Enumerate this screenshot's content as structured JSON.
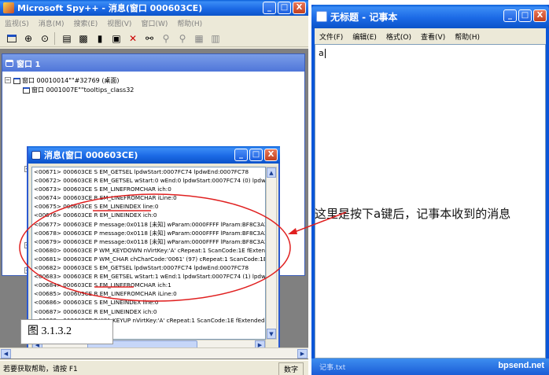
{
  "spy": {
    "title": "Microsoft Spy++ - 消息(窗口 000603CE)",
    "menu": [
      "监视(S)",
      "消息(M)",
      "搜索(E)",
      "视图(V)",
      "窗口(W)",
      "帮助(H)"
    ],
    "toolbar_icons": [
      "new-window-icon",
      "find-window-icon",
      "spy-icon",
      "messages-icon",
      "log-icon",
      "clear-icon",
      "delete-icon",
      "binoculars-icon",
      "find-next-icon",
      "find-prev-icon",
      "properties-icon",
      "refresh-icon"
    ],
    "status": "若要获取帮助，请按 F1",
    "status_num": "数字",
    "window_buttons": {
      "minimize": "_",
      "maximize": "□",
      "close": "X"
    }
  },
  "tree_window": {
    "title": "窗口 1",
    "rows": [
      "窗口 00010014\"\"#32769 (桌面)",
      "窗口 0001007E\"\"tooltips_class32"
    ]
  },
  "messages_window": {
    "title": "消息(窗口 000603CE)",
    "lines": [
      "<00671> 000603CE S EM_GETSEL lpdwStart:0007FC74 lpdwEnd:0007FC78",
      "<00672> 000603CE R EM_GETSEL wStart:0 wEnd:0 lpdwStart:0007FC74 (0) lpdwEn",
      "<00673> 000603CE S EM_LINEFROMCHAR ich:0",
      "<00674> 000603CE R EM_LINEFROMCHAR iLine:0",
      "<00675> 000603CE S EM_LINEINDEX line:0",
      "<00676> 000603CE R EM_LINEINDEX ich:0",
      "<00677> 000603CE P message:0x0118 [未知] wParam:0000FFFF lParam:BF8C3A21",
      "<00678> 000603CE P message:0x0118 [未知] wParam:0000FFFF lParam:BF8C3A21",
      "<00679> 000603CE P message:0x0118 [未知] wParam:0000FFFF lParam:BF8C3A21",
      "<00680> 000603CE P WM_KEYDOWN nVirtKey:'A' cRepeat:1 ScanCode:1E fExtend",
      "<00681> 000603CE P WM_CHAR chCharCode:'0061' (97) cRepeat:1 ScanCode:1E",
      "<00682> 000603CE S EM_GETSEL lpdwStart:0007FC74 lpdwEnd:0007FC78",
      "<00683> 000603CE R EM_GETSEL wStart:1 wEnd:1 lpdwStart:0007FC74 (1) lpdwEr",
      "<00684> 000603CE S EM_LINEFROMCHAR ich:1",
      "<00685> 000603CE R EM_LINEFROMCHAR iLine:0",
      "<00686> 000603CE S EM_LINEINDEX line:0",
      "<00687> 000603CE R EM_LINEINDEX ich:0",
      "<00688> 000603CE P WM_KEYUP nVirtKey:'A' cRepeat:1 ScanCode:1E fExtended"
    ]
  },
  "figure_caption": "图 3.1.3.2",
  "annotation": "这里是按下a键后，记事本收到的消息",
  "notepad": {
    "title": "无标题 - 记事本",
    "menu": [
      "文件(F)",
      "编辑(E)",
      "格式(O)",
      "查看(V)",
      "帮助(H)"
    ],
    "content": "a",
    "taskbar_text": "记事.txt",
    "watermark": "bpsend.net"
  },
  "colors": {
    "xp_blue": "#0b53c9",
    "annotation_red": "#e02020",
    "close_red": "#c1401f"
  }
}
